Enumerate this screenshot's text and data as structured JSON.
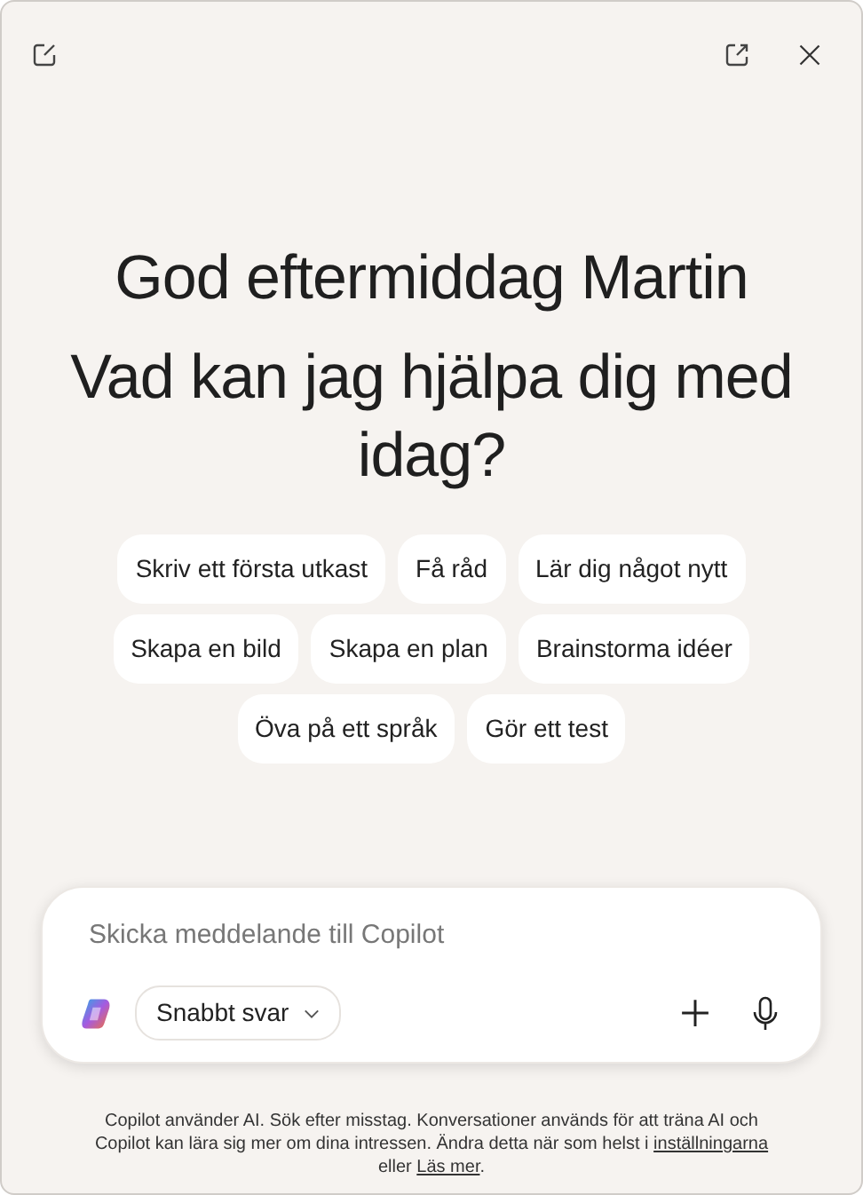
{
  "greeting": "God eftermiddag Martin",
  "question": "Vad kan jag hjälpa dig med idag?",
  "suggestion_rows": [
    [
      {
        "label": "Skriv ett första utkast"
      },
      {
        "label": "Få råd"
      },
      {
        "label": "Lär dig något nytt"
      }
    ],
    [
      {
        "label": "Skapa en bild"
      },
      {
        "label": "Skapa en plan"
      },
      {
        "label": "Brainstorma idéer"
      }
    ],
    [
      {
        "label": "Öva på ett språk"
      },
      {
        "label": "Gör ett test"
      }
    ]
  ],
  "composer": {
    "placeholder": "Skicka meddelande till Copilot",
    "mode": "Snabbt svar"
  },
  "notice": {
    "text": "Copilot använder AI. Sök efter misstag. Konversationer används för att träna AI och Copilot kan lära sig mer om dina intressen. Ändra detta när som helst i",
    "settings_link": "inställningarna",
    "joiner": "eller",
    "read_more_link": "Läs mer",
    "end": "."
  }
}
